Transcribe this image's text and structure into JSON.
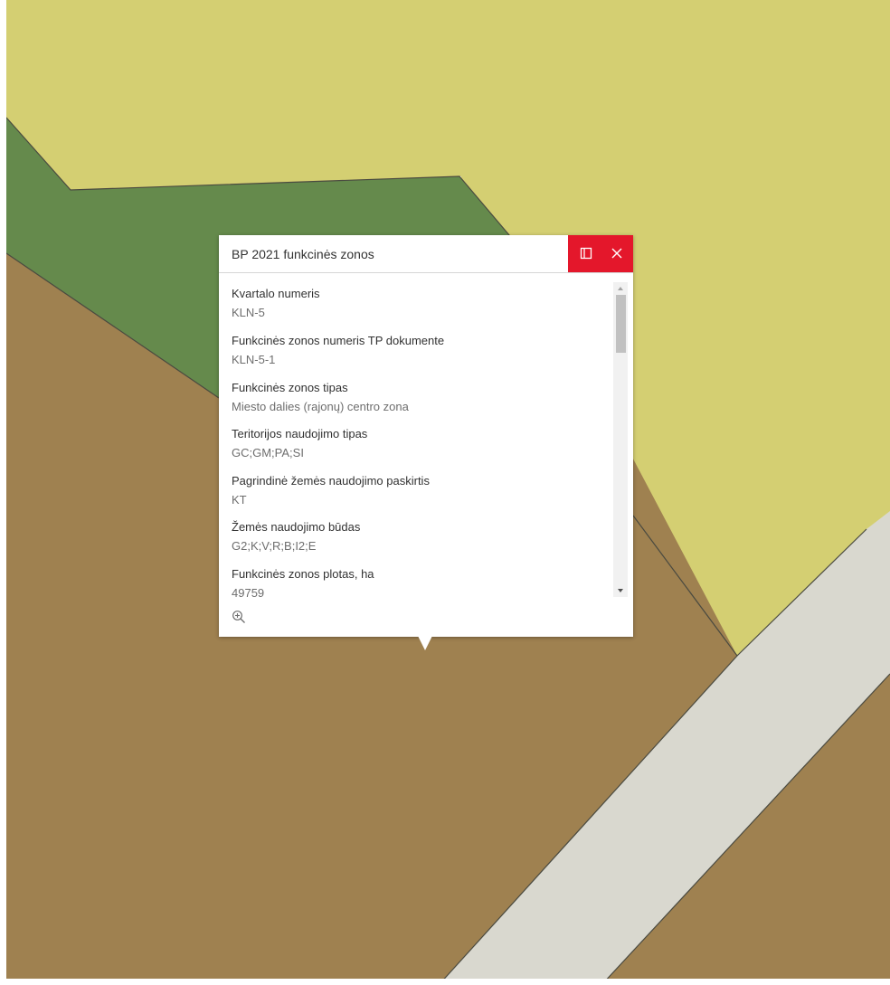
{
  "map": {
    "colors": {
      "yellow_zone": "#d4cf72",
      "green_zone": "#658a4c",
      "brown_zone": "#9f8150",
      "road": "#d9d8cf",
      "boundary": "#4a4a40"
    }
  },
  "popup": {
    "title": "BP 2021 funkcinės zonos",
    "header_color": "#e4172b",
    "actions": {
      "dock_icon": "dock-icon",
      "close_icon": "close-icon"
    },
    "fields": [
      {
        "label": "Kvartalo numeris",
        "value": "KLN-5"
      },
      {
        "label": "Funkcinės zonos numeris TP dokumente",
        "value": "KLN-5-1"
      },
      {
        "label": "Funkcinės zonos tipas",
        "value": "Miesto dalies (rajonų) centro zona"
      },
      {
        "label": "Teritorijos naudojimo tipas",
        "value": "GC;GM;PA;SI"
      },
      {
        "label": "Pagrindinė žemės naudojimo paskirtis",
        "value": "KT"
      },
      {
        "label": "Žemės naudojimo būdas",
        "value": "G2;K;V;R;B;I2;E"
      },
      {
        "label": "Funkcinės zonos plotas, ha",
        "value": "49759"
      }
    ],
    "footer": {
      "zoom_icon": "zoom-in-icon"
    }
  }
}
